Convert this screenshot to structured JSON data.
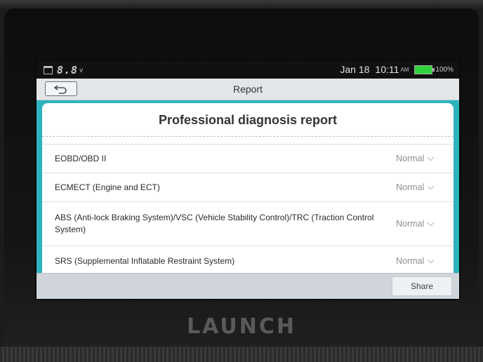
{
  "statusbar": {
    "voltage": "8.8",
    "voltage_unit": "v",
    "date": "Jan 18",
    "time": "10:11",
    "ampm": "AM",
    "battery_percent": "100%",
    "battery_color": "#2fd33c",
    "icons": [
      "calendar-icon",
      "battery-icon"
    ]
  },
  "titlebar": {
    "title": "Report",
    "back_icon": "back-arrow-icon"
  },
  "report": {
    "heading": "Professional diagnosis report",
    "rows": [
      {
        "label": "EOBD/OBD II",
        "status": "Normal"
      },
      {
        "label": "ECMECT (Engine and ECT)",
        "status": "Normal"
      },
      {
        "label": "ABS (Anti-lock Braking System)/VSC (Vehicle Stability Control)/TRC (Traction Control System)",
        "status": "Normal"
      },
      {
        "label": "SRS (Supplemental Inflatable Restraint System)",
        "status": "Normal"
      }
    ]
  },
  "footer": {
    "share_label": "Share"
  },
  "device": {
    "brand": "LAUNCH",
    "accent_color": "#2cb3bf"
  }
}
